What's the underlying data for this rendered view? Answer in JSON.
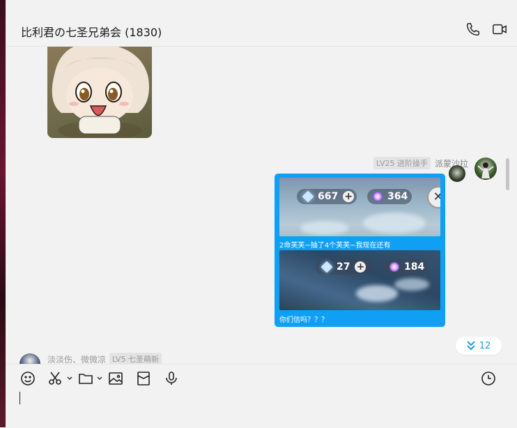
{
  "window": {
    "title": "比利君の七圣兄弟会 (1830)"
  },
  "header": {
    "phone_icon": "phone-icon",
    "video_icon": "video-icon"
  },
  "messages": {
    "sender_level": "LV25 进阶操手",
    "sender_name": "派蒙沙拉",
    "shot1": {
      "primogems": "667",
      "fates": "364"
    },
    "caption1": "2命芙芙~抽了4个芙芙~我现在还有",
    "shot2": {
      "primogems": "27",
      "fates": "184"
    },
    "caption2": "你们信吗？？？",
    "new_count": "12",
    "other_name": "淡淡伤、微微凉",
    "other_level": "LV5 七圣萌新"
  },
  "colors": {
    "bubble": "#0fa0f5",
    "accent": "#1c9be6"
  },
  "toolbar": {
    "icons": [
      "emoji-icon",
      "scissors-icon",
      "folder-icon",
      "image-icon",
      "red-packet-icon",
      "microphone-icon",
      "history-clock-icon"
    ]
  }
}
